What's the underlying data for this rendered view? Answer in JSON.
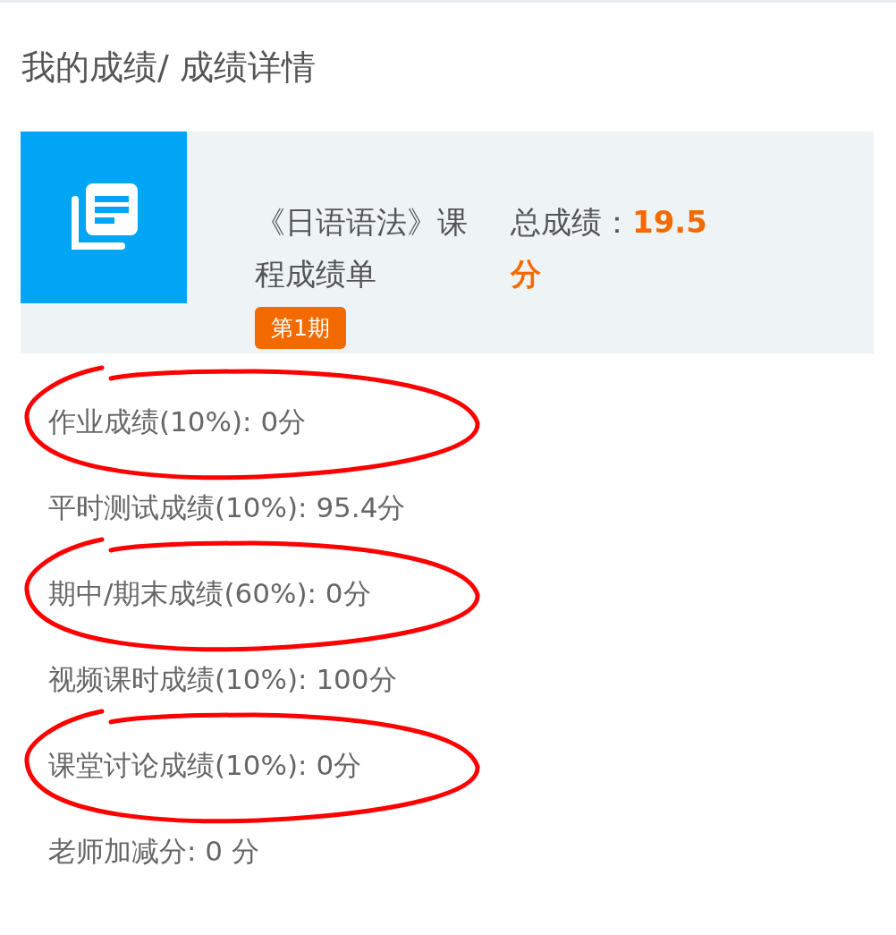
{
  "breadcrumb": "我的成绩/ 成绩详情",
  "course": {
    "name": "《日语语法》课程成绩单",
    "total_label": "总成绩：",
    "total_value": "19.5分",
    "term": "第1期"
  },
  "items": [
    {
      "text": "作业成绩(10%): 0分",
      "circled": true
    },
    {
      "text": "平时测试成绩(10%): 95.4分",
      "circled": false
    },
    {
      "text": "期中/期末成绩(60%): 0分",
      "circled": true
    },
    {
      "text": "视频课时成绩(10%): 100分",
      "circled": false
    },
    {
      "text": "课堂讨论成绩(10%): 0分",
      "circled": true
    },
    {
      "text": "老师加减分: 0 分",
      "circled": false
    }
  ]
}
